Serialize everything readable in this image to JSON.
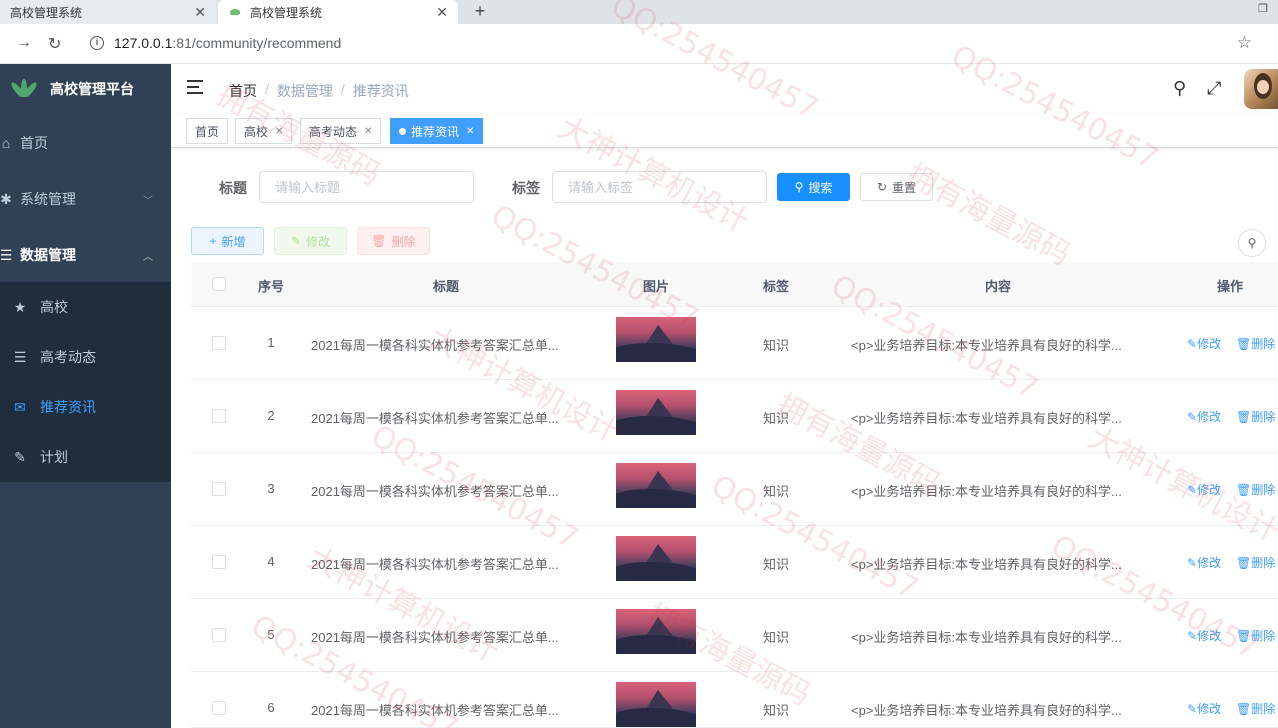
{
  "browser": {
    "tabs": [
      {
        "title": "高校管理系统"
      },
      {
        "title": "高校管理系统"
      }
    ],
    "new_tab_icon": "+",
    "url_host": "127.0.0.1",
    "url_path": ":81/community/recommend"
  },
  "sidebar": {
    "brand": "高校管理平台",
    "items": [
      {
        "label": "首页",
        "icon": "home-icon"
      },
      {
        "label": "系统管理",
        "icon": "gear-icon"
      },
      {
        "label": "数据管理",
        "icon": "menu-icon"
      }
    ],
    "sub_items": [
      {
        "label": "高校",
        "icon": "star-icon"
      },
      {
        "label": "高考动态",
        "icon": "list-icon"
      },
      {
        "label": "推荐资讯",
        "icon": "message-icon"
      },
      {
        "label": "计划",
        "icon": "edit-icon"
      }
    ],
    "active_color": "#409eff",
    "bg_color": "#304156"
  },
  "navbar": {
    "breadcrumb": [
      "首页",
      "数据管理",
      "推荐资讯"
    ]
  },
  "tags_view": [
    {
      "label": "首页",
      "closable": false
    },
    {
      "label": "高校",
      "closable": true
    },
    {
      "label": "高考动态",
      "closable": true
    },
    {
      "label": "推荐资讯",
      "closable": true,
      "active": true
    }
  ],
  "search": {
    "title_label": "标题",
    "title_placeholder": "请输入标题",
    "tag_label": "标签",
    "tag_placeholder": "请输入标签",
    "search_button": "搜索",
    "reset_button": "重置"
  },
  "toolbar": {
    "add": "新增",
    "edit": "修改",
    "delete": "删除"
  },
  "table": {
    "columns": [
      "序号",
      "标题",
      "图片",
      "标签",
      "内容",
      "操作"
    ],
    "rows": [
      {
        "no": "1",
        "title": "2021每周一模各科实体机参考答案汇总单...",
        "tag": "知识",
        "content": "<p>业务培养目标:本专业培养具有良好的科学..."
      },
      {
        "no": "2",
        "title": "2021每周一模各科实体机参考答案汇总单...",
        "tag": "知识",
        "content": "<p>业务培养目标:本专业培养具有良好的科学..."
      },
      {
        "no": "3",
        "title": "2021每周一模各科实体机参考答案汇总单...",
        "tag": "知识",
        "content": "<p>业务培养目标:本专业培养具有良好的科学..."
      },
      {
        "no": "4",
        "title": "2021每周一模各科实体机参考答案汇总单...",
        "tag": "知识",
        "content": "<p>业务培养目标:本专业培养具有良好的科学..."
      },
      {
        "no": "5",
        "title": "2021每周一模各科实体机参考答案汇总单...",
        "tag": "知识",
        "content": "<p>业务培养目标:本专业培养具有良好的科学..."
      },
      {
        "no": "6",
        "title": "2021每周一模各科实体机参考答案汇总单...",
        "tag": "知识",
        "content": "<p>业务培养目标:本专业培养具有良好的科学..."
      }
    ],
    "row_edit": "修改",
    "row_delete": "删除"
  },
  "watermarks": [
    "QQ:254540457",
    "大神计算机设计",
    "拥有海量源码"
  ]
}
